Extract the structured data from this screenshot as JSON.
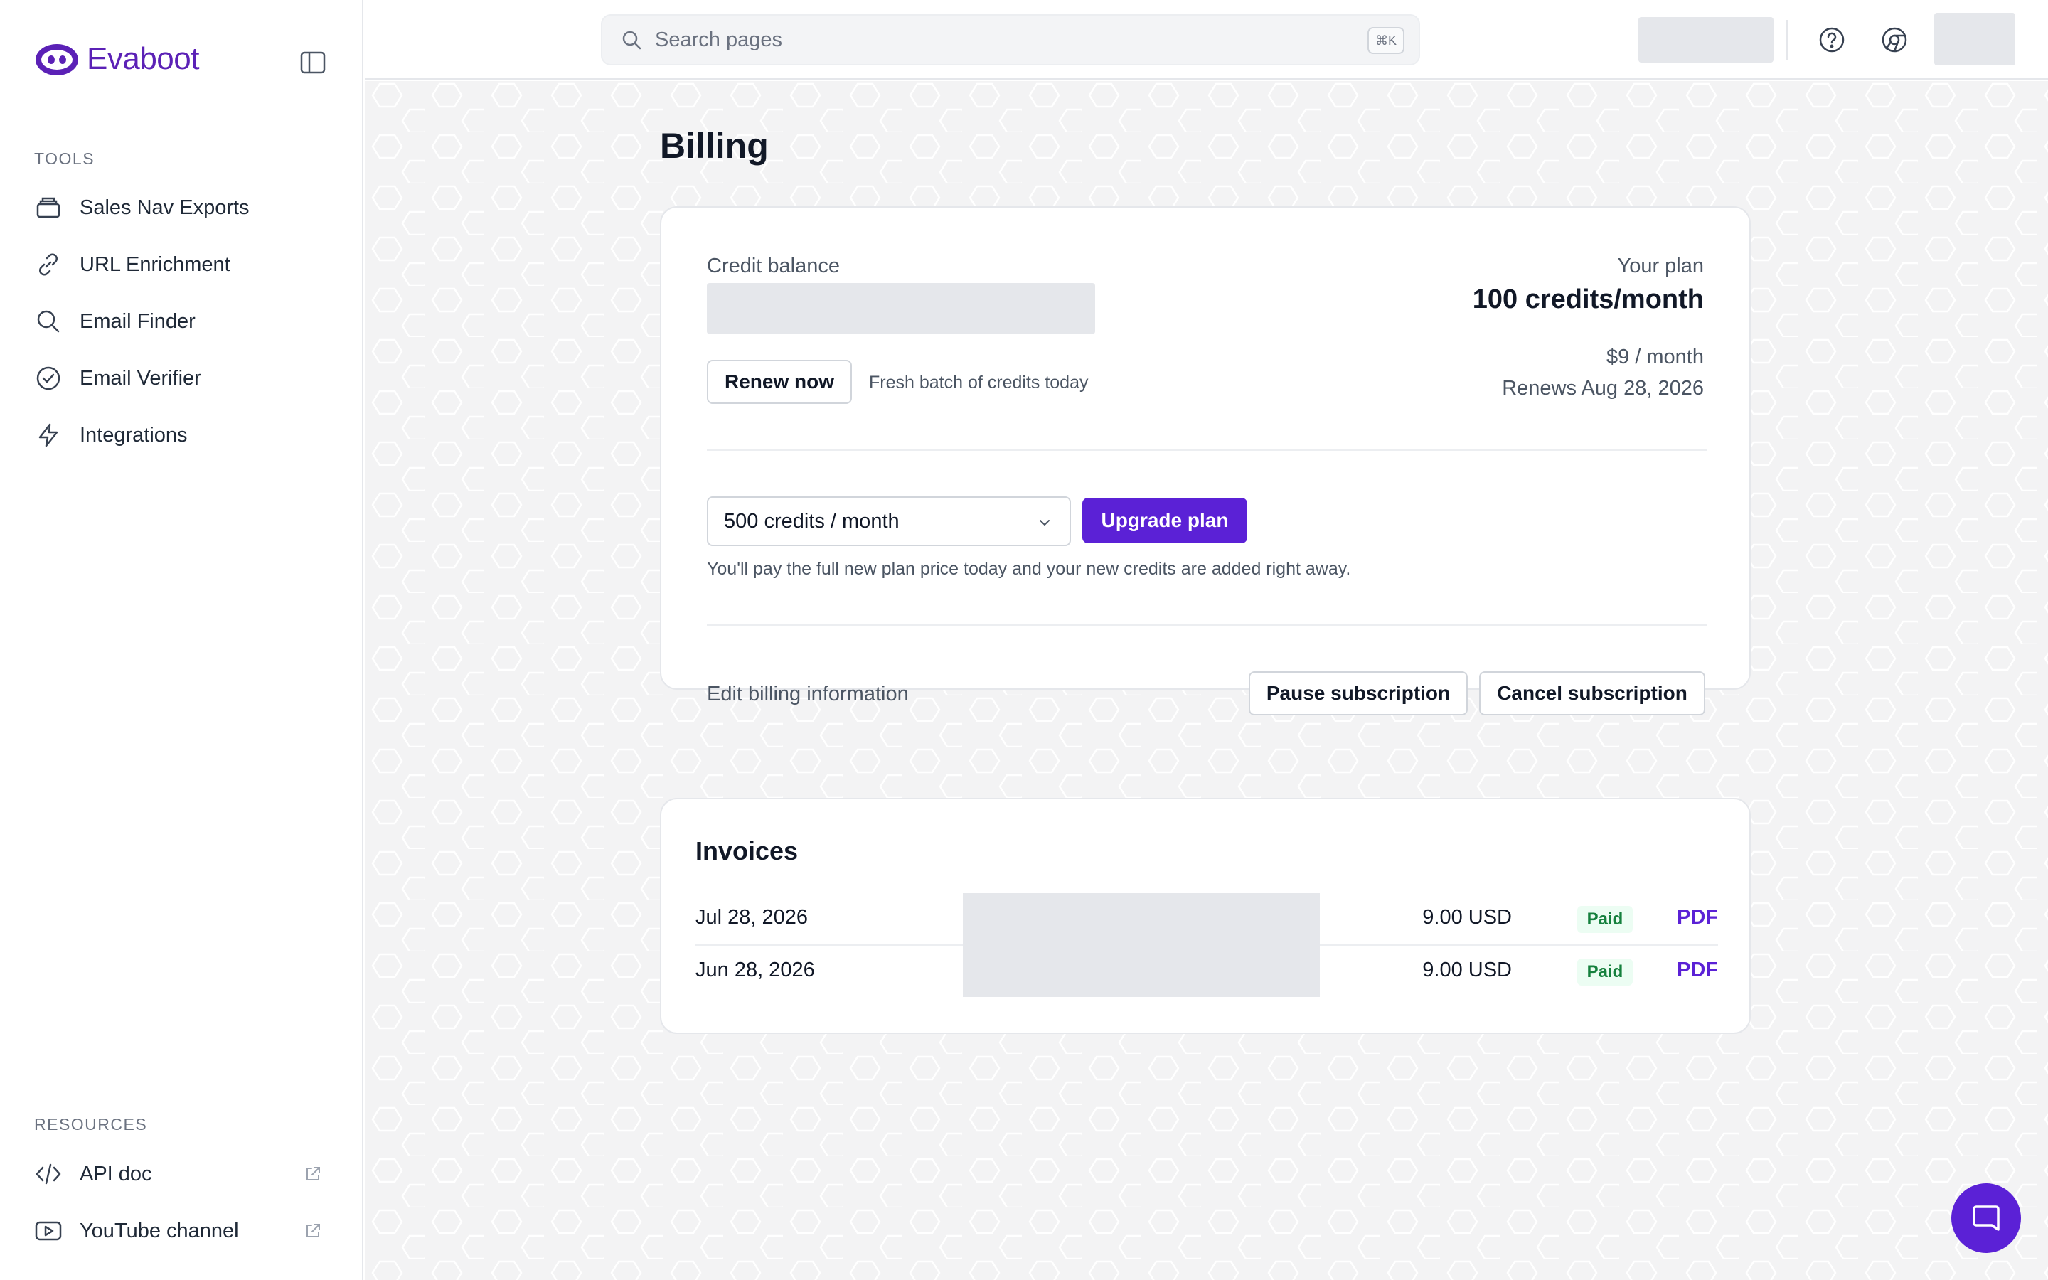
{
  "brand": {
    "name": "Evaboot"
  },
  "sidebar": {
    "tools_label": "TOOLS",
    "tools": [
      {
        "label": "Sales Nav Exports",
        "icon": "stack-icon"
      },
      {
        "label": "URL Enrichment",
        "icon": "link-icon"
      },
      {
        "label": "Email Finder",
        "icon": "search-icon"
      },
      {
        "label": "Email Verifier",
        "icon": "check-circle-icon"
      },
      {
        "label": "Integrations",
        "icon": "bolt-icon"
      }
    ],
    "resources_label": "RESOURCES",
    "resources": [
      {
        "label": "API doc",
        "icon": "code-icon"
      },
      {
        "label": "YouTube channel",
        "icon": "video-icon"
      }
    ]
  },
  "topbar": {
    "search_placeholder": "Search pages",
    "search_shortcut": "⌘K"
  },
  "page": {
    "title": "Billing"
  },
  "billing": {
    "credit_balance_label": "Credit balance",
    "renew_label": "Renew now",
    "renew_note": "Fresh batch of credits today",
    "plan_label": "Your plan",
    "plan_name": "100 credits/month",
    "plan_price": "$9 / month",
    "renews": "Renews Aug 28, 2026",
    "upgrade_select_value": "500 credits / month",
    "upgrade_button": "Upgrade plan",
    "upgrade_note": "You'll pay the full new plan price today and your new credits are added right away.",
    "edit_billing": "Edit billing information",
    "pause_button": "Pause subscription",
    "cancel_button": "Cancel subscription"
  },
  "invoices": {
    "title": "Invoices",
    "rows": [
      {
        "date": "Jul 28, 2026",
        "amount": "9.00 USD",
        "status": "Paid",
        "link": "PDF"
      },
      {
        "date": "Jun 28, 2026",
        "amount": "9.00 USD",
        "status": "Paid",
        "link": "PDF"
      }
    ]
  },
  "colors": {
    "accent": "#5b21d6",
    "brand": "#5b21b6",
    "paid_text": "#15803d",
    "paid_bg": "#ecfdf3"
  }
}
